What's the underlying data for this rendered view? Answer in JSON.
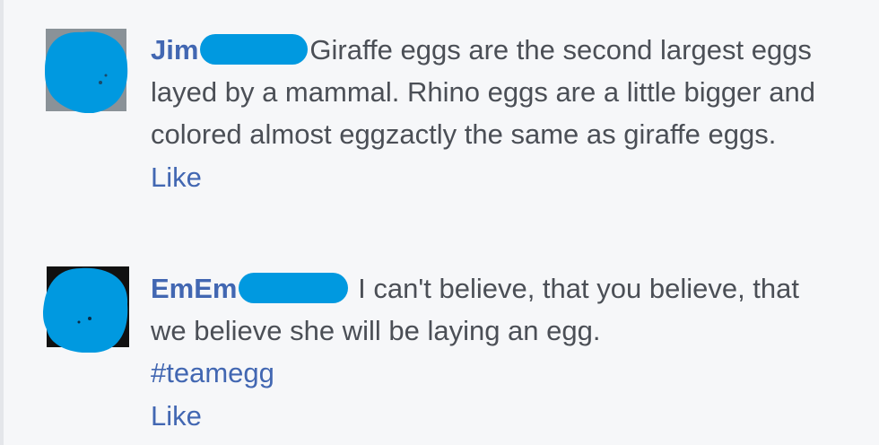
{
  "colors": {
    "background": "#f6f7f9",
    "author": "#4267b2",
    "text": "#4b4f56",
    "link": "#4267b2",
    "redaction": "#0099e0"
  },
  "comments": [
    {
      "author": "Jim",
      "text": "Giraffe eggs are the second largest eggs layed by a mammal. Rhino eggs are a little bigger and colored almost eggzactly the same as giraffe eggs.",
      "hashtag": "",
      "like_label": "Like"
    },
    {
      "author": "EmEm",
      "text": "I can't believe, that you believe, that we believe she will be laying an egg.",
      "hashtag": "#teamegg",
      "like_label": "Like"
    }
  ]
}
